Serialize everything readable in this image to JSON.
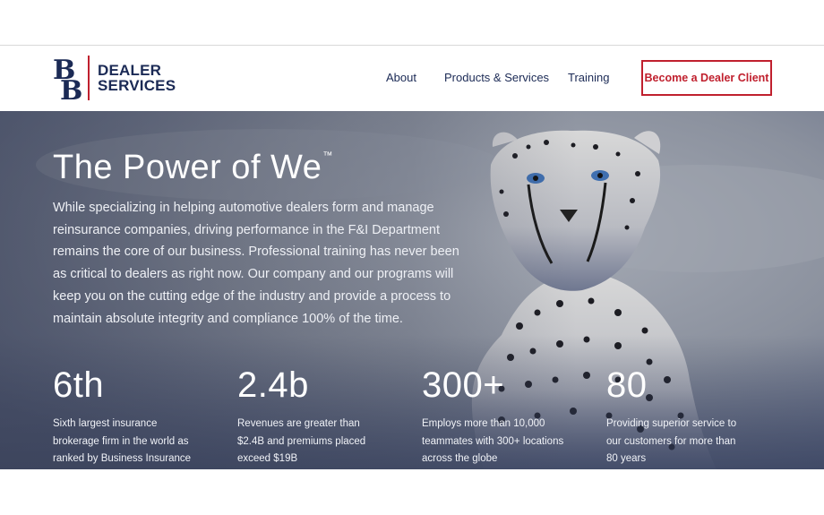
{
  "brand": {
    "logo_line1": "DEALER",
    "logo_line2": "SERVICES",
    "accent_color": "#c0202e",
    "navy_color": "#1b2a55"
  },
  "nav": {
    "items": [
      {
        "label": "About"
      },
      {
        "label": "Products & Services"
      },
      {
        "label": "Training"
      }
    ],
    "cta_label": "Become a Dealer Client"
  },
  "hero": {
    "title": "The Power of We",
    "title_mark": "™",
    "body": "While specializing in helping automotive dealers form and manage reinsurance companies, driving performance in the F&I Department remains the core of our business. Professional training has never been as critical to dealers as right now. Our company and our programs will keep you on the cutting edge of the industry and provide a process to maintain absolute integrity and compliance 100% of the time.",
    "stats": [
      {
        "value": "6th",
        "description": "Sixth largest insurance brokerage firm in the world as ranked by Business Insurance"
      },
      {
        "value": "2.4b",
        "description": "Revenues are greater than $2.4B and premiums placed exceed $19B"
      },
      {
        "value": "300+",
        "description": "Employs more than 10,000 teammates with 300+ locations across the globe"
      },
      {
        "value": "80",
        "description": "Providing superior service to our customers for more than 80 years"
      }
    ]
  }
}
